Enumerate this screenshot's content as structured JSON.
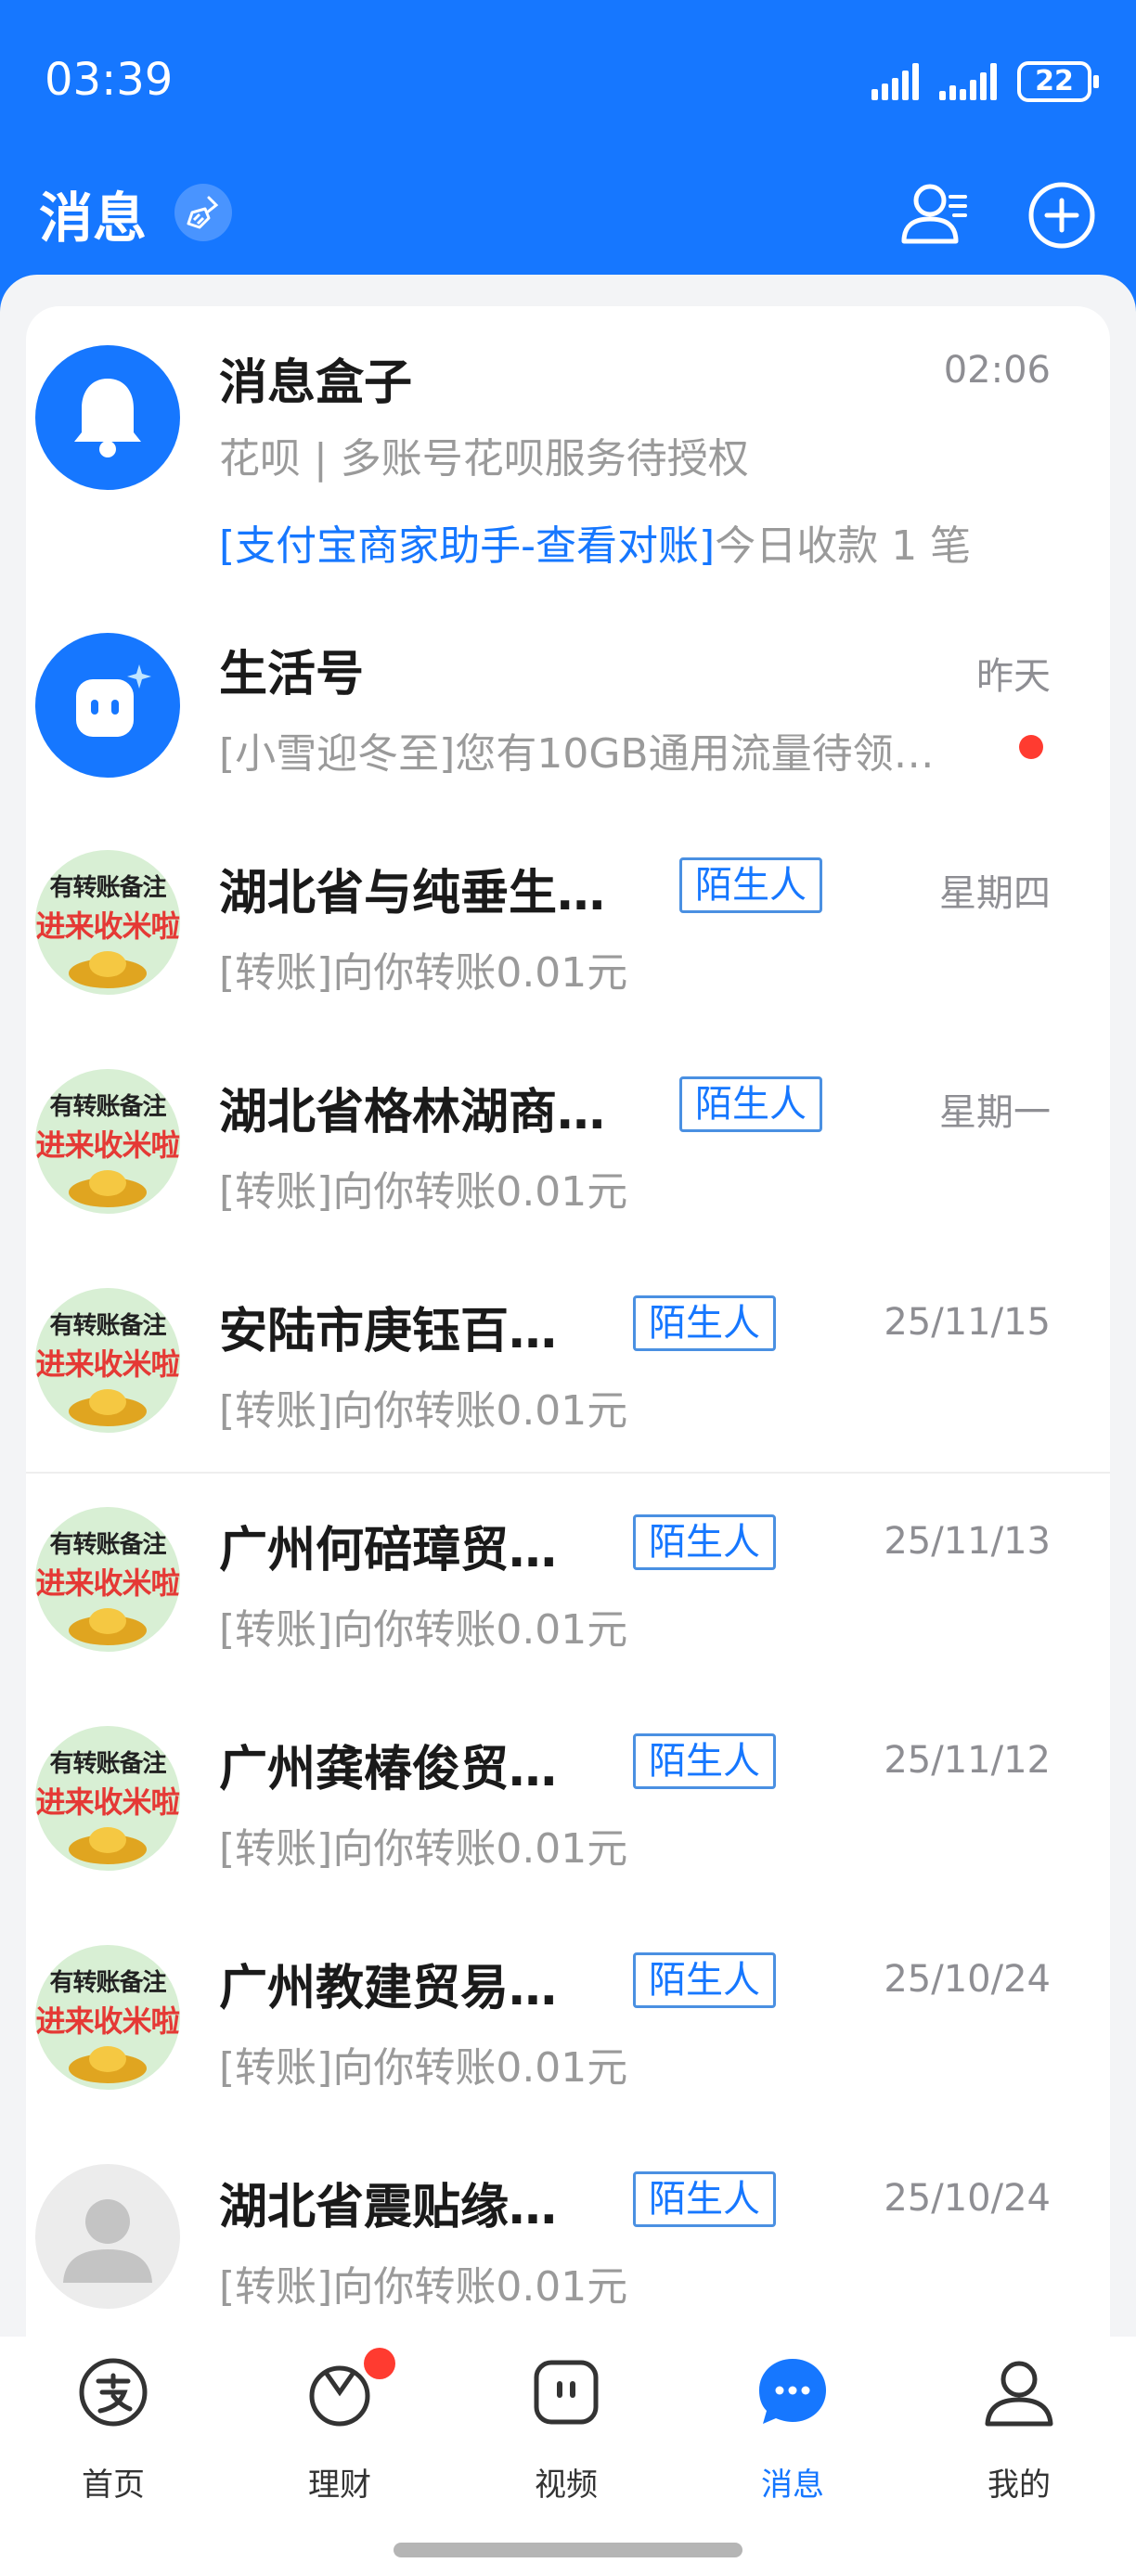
{
  "status_bar": {
    "time": "03:39",
    "battery": "22"
  },
  "header": {
    "title": "消息"
  },
  "messages": [
    {
      "name": "消息盒子",
      "time": "02:06",
      "line1": "花呗 | 多账号花呗服务待授权",
      "link": "[支付宝商家助手-查看对账]",
      "line2_rest": "今日收款 1 笔",
      "avatar": "bell-icon"
    },
    {
      "name": "生活号",
      "time": "昨天",
      "line1": "[小雪迎冬至]您有10GB通用流量待领…",
      "avatar": "chat-bot-icon"
    },
    {
      "name": "湖北省与纯垂生…",
      "tag": "陌生人",
      "time": "星期四",
      "line1": "[转账]向你转账0.01元",
      "avatar_l1": "有转账备注",
      "avatar_l2": "进来收米啦"
    },
    {
      "name": "湖北省格林湖商…",
      "tag": "陌生人",
      "time": "星期一",
      "line1": "[转账]向你转账0.01元",
      "avatar_l1": "有转账备注",
      "avatar_l2": "进来收米啦"
    },
    {
      "name": "安陆市庚钰百…",
      "tag": "陌生人",
      "time": "25/11/15",
      "line1": "[转账]向你转账0.01元",
      "avatar_l1": "有转账备注",
      "avatar_l2": "进来收米啦"
    },
    {
      "name": "广州何碚璋贸…",
      "tag": "陌生人",
      "time": "25/11/13",
      "line1": "[转账]向你转账0.01元",
      "avatar_l1": "有转账备注",
      "avatar_l2": "进来收米啦"
    },
    {
      "name": "广州龚椿俊贸…",
      "tag": "陌生人",
      "time": "25/11/12",
      "line1": "[转账]向你转账0.01元",
      "avatar_l1": "有转账备注",
      "avatar_l2": "进来收米啦"
    },
    {
      "name": "广州教建贸易…",
      "tag": "陌生人",
      "time": "25/10/24",
      "line1": "[转账]向你转账0.01元",
      "avatar_l1": "有转账备注",
      "avatar_l2": "进来收米啦"
    },
    {
      "name": "湖北省震贴缘…",
      "tag": "陌生人",
      "time": "25/10/24",
      "line1": "[转账]向你转账0.01元",
      "avatar": "default-user-icon"
    }
  ],
  "tabbar": [
    {
      "label": "首页",
      "icon": "alipay-icon"
    },
    {
      "label": "理财",
      "icon": "wealth-icon"
    },
    {
      "label": "视频",
      "icon": "video-icon"
    },
    {
      "label": "消息",
      "icon": "message-icon",
      "active": true
    },
    {
      "label": "我的",
      "icon": "profile-icon"
    }
  ],
  "colors": {
    "brand": "#1677ff",
    "badge": "#ff3b30",
    "avatar_green": "#d8efd4"
  }
}
